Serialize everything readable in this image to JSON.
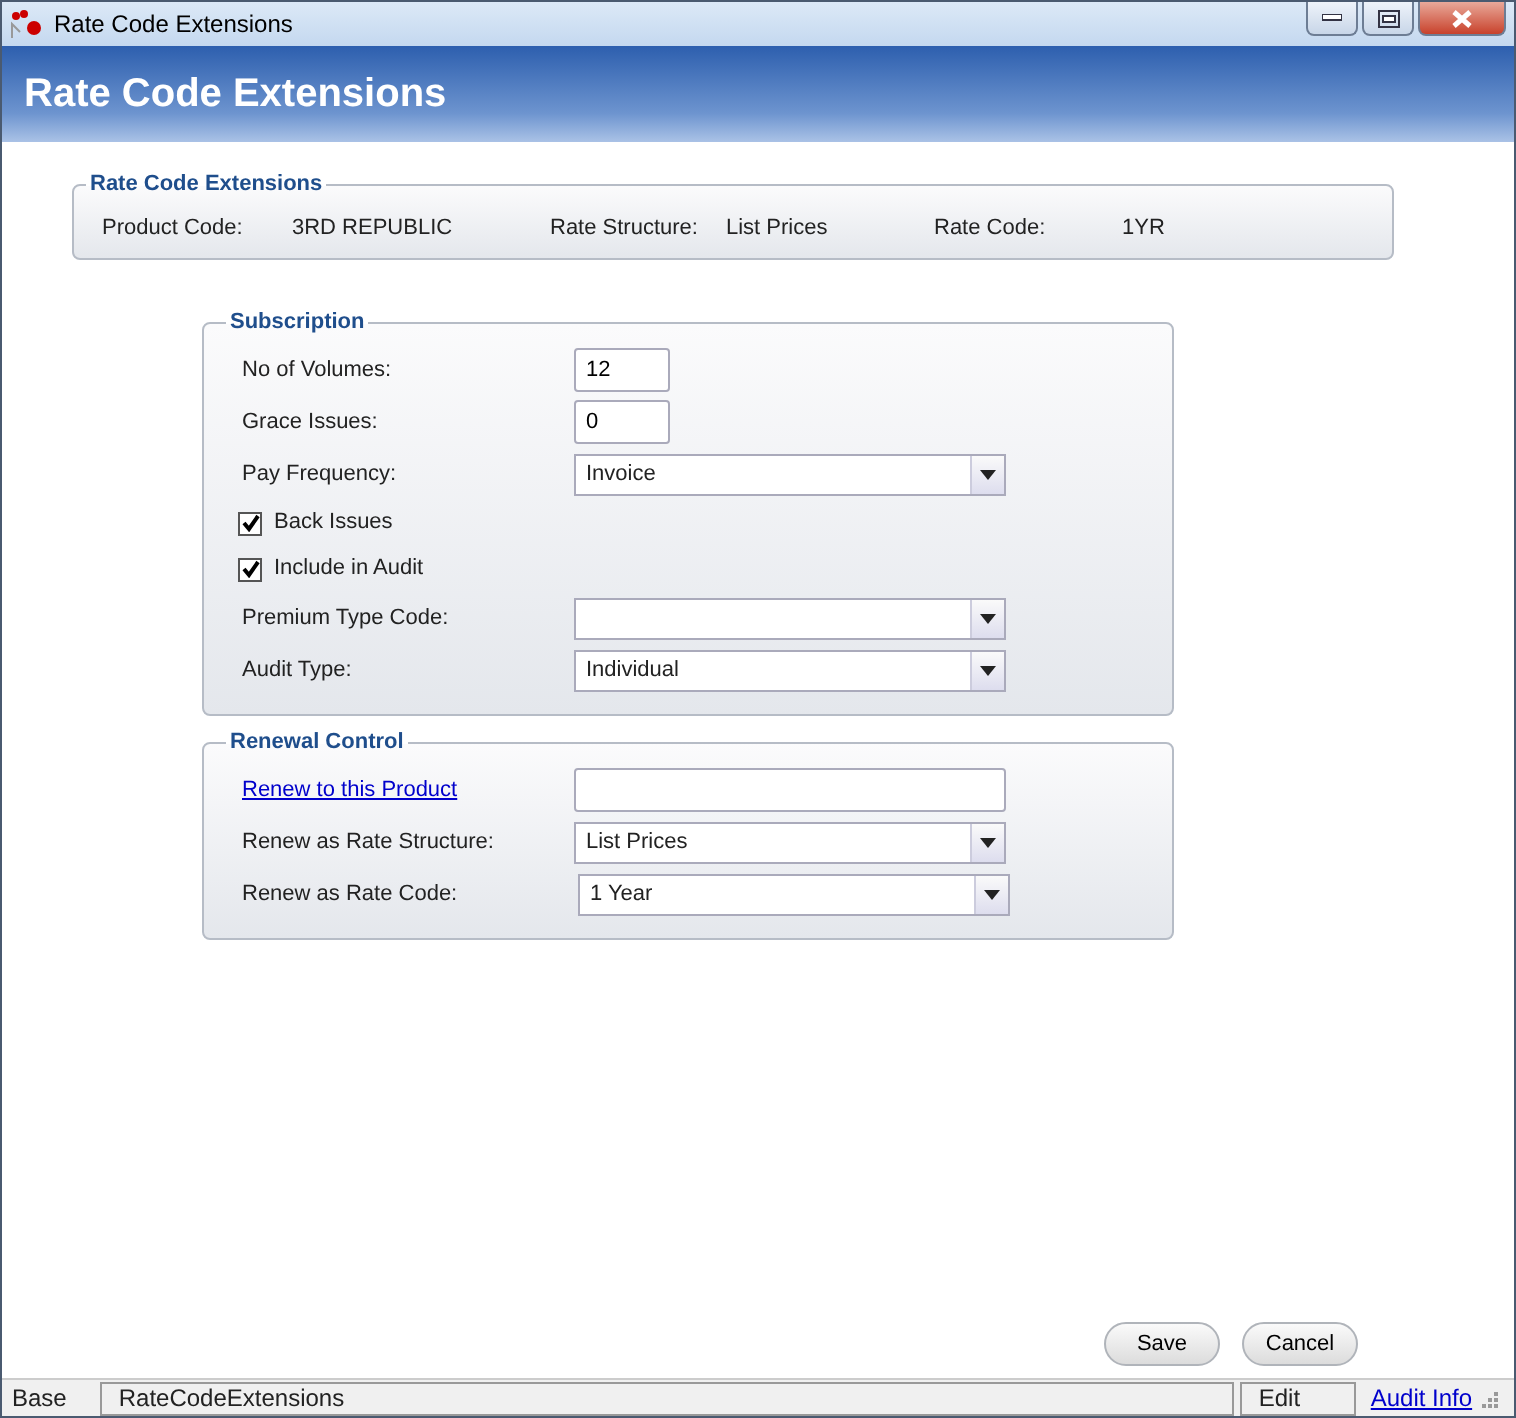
{
  "window": {
    "title": "Rate Code Extensions"
  },
  "header": {
    "title": "Rate Code Extensions"
  },
  "summary": {
    "title": "Rate Code Extensions",
    "items": [
      {
        "label": "Product Code:",
        "value": "3RD REPUBLIC"
      },
      {
        "label": "Rate Structure:",
        "value": "List Prices"
      },
      {
        "label": "Rate Code:",
        "value": "1YR"
      }
    ]
  },
  "subscription": {
    "title": "Subscription",
    "fields": [
      {
        "kind": "text",
        "label": "No of Volumes:",
        "value": "12"
      },
      {
        "kind": "text",
        "label": "Grace Issues:",
        "value": "0"
      },
      {
        "kind": "select",
        "label": "Pay Frequency:",
        "value": "Invoice"
      },
      {
        "kind": "checkbox",
        "label": "Back Issues",
        "checked": true
      },
      {
        "kind": "checkbox",
        "label": "Include in Audit",
        "checked": true
      },
      {
        "kind": "select",
        "label": "Premium Type Code:"
      },
      {
        "kind": "select",
        "label": "Audit Type:",
        "value": "Individual"
      }
    ]
  },
  "renewal": {
    "title": "Renewal Control",
    "fields": [
      {
        "kind": "link-text",
        "label": "Renew to this Product"
      },
      {
        "kind": "select",
        "label": "Renew as Rate Structure:",
        "value": "List Prices"
      },
      {
        "kind": "select",
        "label": "Renew as Rate Code:",
        "value": "1 Year"
      }
    ]
  },
  "buttons": [
    "Save",
    "Cancel"
  ],
  "status_bar": {
    "module": "Base",
    "form": "RateCodeExtensions",
    "mode": "Edit",
    "link": "Audit Info"
  }
}
